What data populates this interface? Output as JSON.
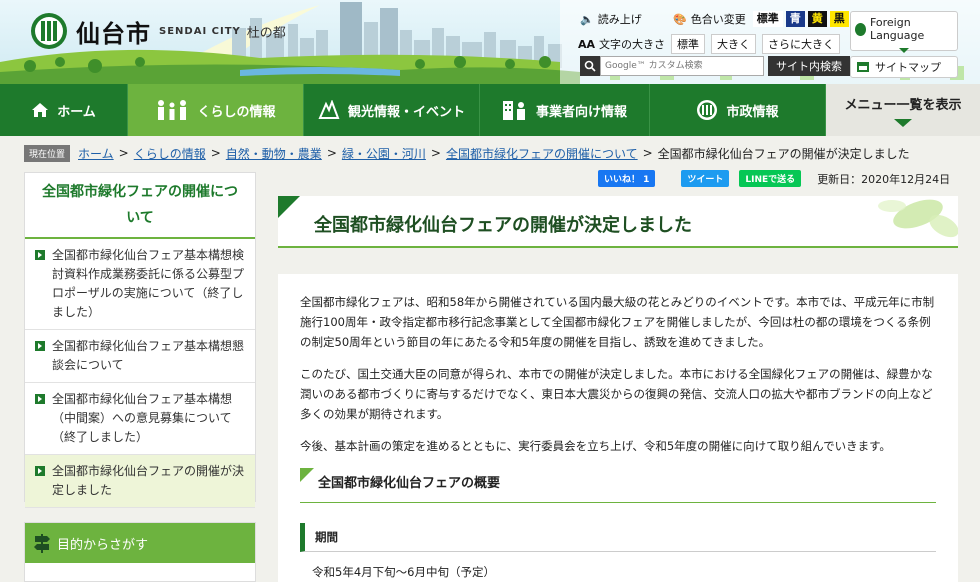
{
  "header": {
    "logo_name": "仙台市",
    "logo_en": "SENDAI CITY",
    "logo_sub": "杜の都",
    "read_aloud": "読み上げ",
    "color_change": "色合い変更",
    "color_options": [
      {
        "label": "標準",
        "bg": "#ffffff",
        "fg": "#111111"
      },
      {
        "label": "青",
        "bg": "#1a3a8a",
        "fg": "#ffffff"
      },
      {
        "label": "黄",
        "bg": "#111111",
        "fg": "#ffe600"
      },
      {
        "label": "黒",
        "bg": "#ffe600",
        "fg": "#111111"
      }
    ],
    "text_size_label": "文字の大きさ",
    "text_size_prefix": "AA",
    "text_sizes": [
      "標準",
      "大きく",
      "さらに大きく"
    ],
    "foreign_language": "Foreign Language",
    "search_placeholder": "Google™ カスタム検索",
    "search_button": "サイト内検索",
    "sitemap": "サイトマップ"
  },
  "nav": {
    "items": [
      "ホーム",
      "くらしの情報",
      "観光情報・イベント",
      "事業者向け情報",
      "市政情報"
    ],
    "menu_list": "メニュー一覧を表示"
  },
  "breadcrumb": {
    "label": "現在位置",
    "links": [
      "ホーム",
      "くらしの情報",
      "自然・動物・農業",
      "緑・公園・河川",
      "全国都市緑化フェアの開催について"
    ],
    "current": "全国都市緑化仙台フェアの開催が決定しました"
  },
  "social": {
    "like": "いいね！ 1",
    "tweet": "ツイート",
    "line": "LINEで送る",
    "updated": "更新日：2020年12月24日"
  },
  "sidebar": {
    "title": "全国都市緑化フェアの開催について",
    "items": [
      {
        "label": "全国都市緑化仙台フェア基本構想検討資料作成業務委託に係る公募型プロポーザルの実施について（終了しました）",
        "active": false
      },
      {
        "label": "全国都市緑化仙台フェア基本構想懇談会について",
        "active": false
      },
      {
        "label": "全国都市緑化仙台フェア基本構想（中間案）への意見募集について（終了しました）",
        "active": false
      },
      {
        "label": "全国都市緑化仙台フェアの開催が決定しました",
        "active": true
      }
    ],
    "purpose": "目的からさがす"
  },
  "main": {
    "title": "全国都市緑化仙台フェアの開催が決定しました",
    "paragraphs": [
      "全国都市緑化フェアは、昭和58年から開催されている国内最大級の花とみどりのイベントです。本市では、平成元年に市制施行100周年・政令指定都市移行記念事業として全国都市緑化フェアを開催しましたが、今回は杜の都の環境をつくる条例の制定50周年という節目の年にあたる令和5年度の開催を目指し、誘致を進めてきました。",
      "このたび、国土交通大臣の同意が得られ、本市での開催が決定しました。本市における全国緑化フェアの開催は、緑豊かな潤いのある都市づくりに寄与するだけでなく、東日本大震災からの復興の発信、交流人口の拡大や都市ブランドの向上など多くの効果が期待されます。",
      "今後、基本計画の策定を進めるとともに、実行委員会を立ち上げ、令和5年度の開催に向けて取り組んでいきます。"
    ],
    "outline_heading": "全国都市緑化仙台フェアの概要",
    "period_heading": "期間",
    "period_value": "令和5年4月下旬～6月中旬（予定）"
  },
  "colors": {
    "brand_green": "#1e7a2c",
    "accent_green": "#6db33f",
    "link_blue": "#1e5fa8"
  }
}
